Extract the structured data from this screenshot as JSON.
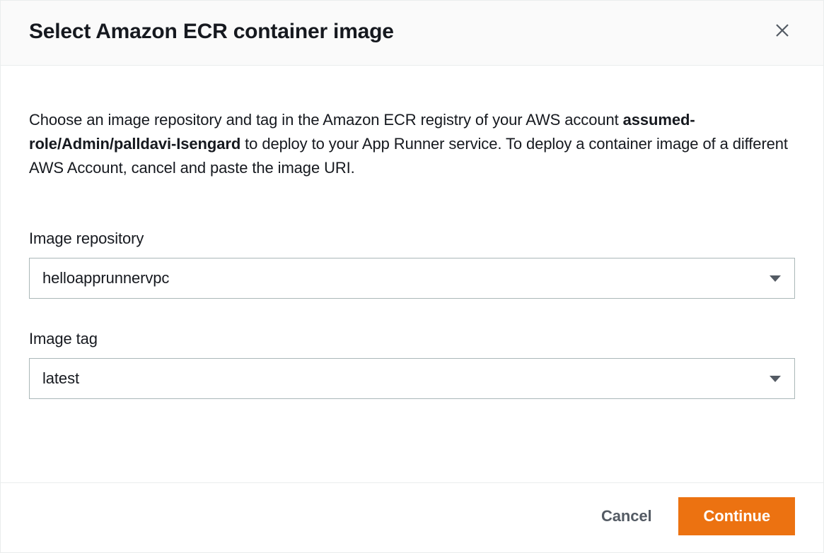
{
  "modal": {
    "title": "Select Amazon ECR container image",
    "description": {
      "text_before": "Choose an image repository and tag in the Amazon ECR registry of your AWS account ",
      "bold_segment": "assumed-role/Admin/palldavi-Isengard",
      "text_after": " to deploy to your App Runner service. To deploy a container image of a different AWS Account, cancel and paste the image URI."
    },
    "fields": {
      "repository": {
        "label": "Image repository",
        "value": "helloapprunnervpc"
      },
      "tag": {
        "label": "Image tag",
        "value": "latest"
      }
    },
    "footer": {
      "cancel_label": "Cancel",
      "continue_label": "Continue"
    }
  }
}
